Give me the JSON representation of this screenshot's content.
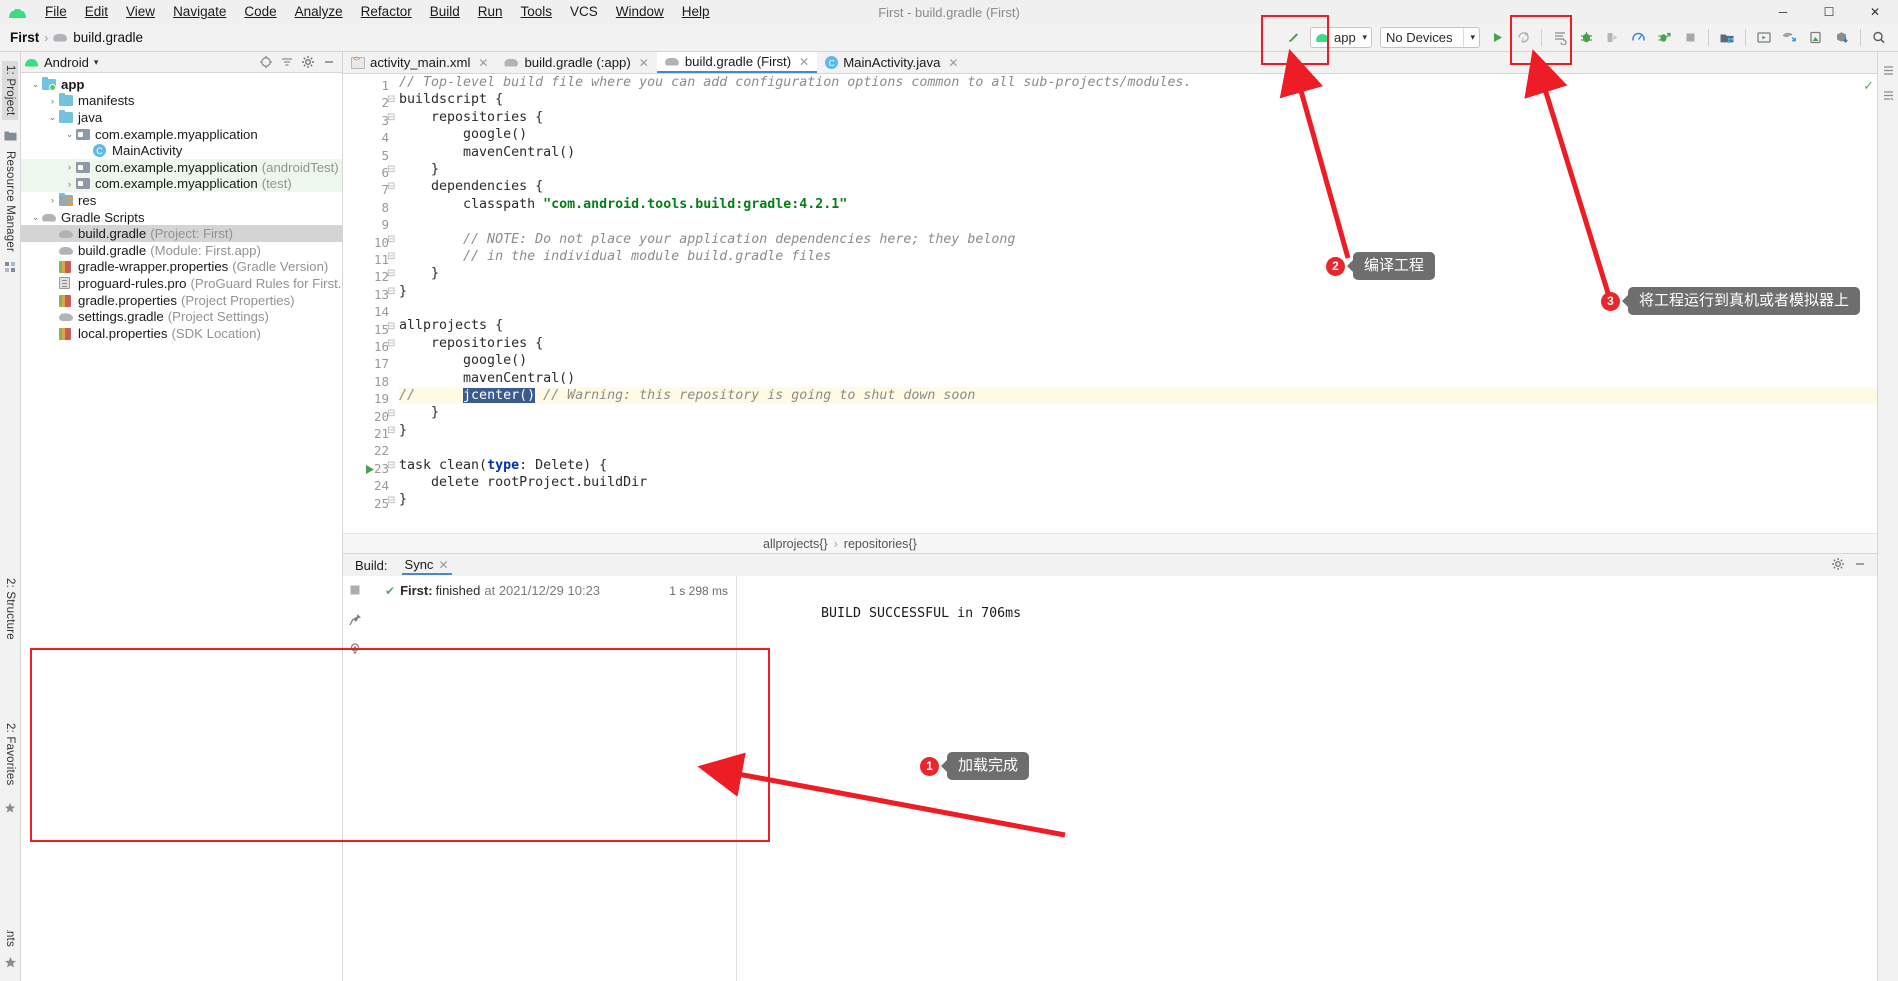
{
  "titlebar": {
    "window_title": "First - build.gradle (First)",
    "menus": [
      "File",
      "Edit",
      "View",
      "Navigate",
      "Code",
      "Analyze",
      "Refactor",
      "Build",
      "Run",
      "Tools",
      "VCS",
      "Window",
      "Help"
    ],
    "minimize": "─",
    "maximize": "☐",
    "close": "✕"
  },
  "navbar": {
    "breadcrumb_project": "First",
    "breadcrumb_separator": "›",
    "breadcrumb_file": "build.gradle",
    "module_combo": "app",
    "device_combo": "No Devices",
    "caret": "▾"
  },
  "tree": {
    "header_title": "Android",
    "items": [
      {
        "indent": 0,
        "arrow": "⌄",
        "icon": "folder-module",
        "name": "app",
        "desc": "",
        "bold": true,
        "selected": false,
        "test": false
      },
      {
        "indent": 1,
        "arrow": "›",
        "icon": "folder",
        "name": "manifests",
        "desc": "",
        "bold": false,
        "selected": false,
        "test": false
      },
      {
        "indent": 1,
        "arrow": "⌄",
        "icon": "folder",
        "name": "java",
        "desc": "",
        "bold": false,
        "selected": false,
        "test": false
      },
      {
        "indent": 2,
        "arrow": "⌄",
        "icon": "package",
        "name": "com.example.myapplication",
        "desc": "",
        "bold": false,
        "selected": false,
        "test": false
      },
      {
        "indent": 3,
        "arrow": "",
        "icon": "class",
        "name": "MainActivity",
        "desc": "",
        "bold": false,
        "selected": false,
        "test": false
      },
      {
        "indent": 2,
        "arrow": "›",
        "icon": "package",
        "name": "com.example.myapplication",
        "desc": "(androidTest)",
        "bold": false,
        "selected": false,
        "test": true
      },
      {
        "indent": 2,
        "arrow": "›",
        "icon": "package",
        "name": "com.example.myapplication",
        "desc": "(test)",
        "bold": false,
        "selected": false,
        "test": true
      },
      {
        "indent": 1,
        "arrow": "›",
        "icon": "folder-res",
        "name": "res",
        "desc": "",
        "bold": false,
        "selected": false,
        "test": false
      },
      {
        "indent": 0,
        "arrow": "⌄",
        "icon": "gradle",
        "name": "Gradle Scripts",
        "desc": "",
        "bold": false,
        "selected": false,
        "test": false
      },
      {
        "indent": 1,
        "arrow": "",
        "icon": "gradle",
        "name": "build.gradle",
        "desc": "(Project: First)",
        "bold": false,
        "selected": true,
        "test": false
      },
      {
        "indent": 1,
        "arrow": "",
        "icon": "gradle",
        "name": "build.gradle",
        "desc": "(Module: First.app)",
        "bold": false,
        "selected": false,
        "test": false
      },
      {
        "indent": 1,
        "arrow": "",
        "icon": "properties",
        "name": "gradle-wrapper.properties",
        "desc": "(Gradle Version)",
        "bold": false,
        "selected": false,
        "test": false
      },
      {
        "indent": 1,
        "arrow": "",
        "icon": "document",
        "name": "proguard-rules.pro",
        "desc": "(ProGuard Rules for First.app)",
        "bold": false,
        "selected": false,
        "test": false
      },
      {
        "indent": 1,
        "arrow": "",
        "icon": "properties",
        "name": "gradle.properties",
        "desc": "(Project Properties)",
        "bold": false,
        "selected": false,
        "test": false
      },
      {
        "indent": 1,
        "arrow": "",
        "icon": "gradle",
        "name": "settings.gradle",
        "desc": "(Project Settings)",
        "bold": false,
        "selected": false,
        "test": false
      },
      {
        "indent": 1,
        "arrow": "",
        "icon": "properties",
        "name": "local.properties",
        "desc": "(SDK Location)",
        "bold": false,
        "selected": false,
        "test": false
      }
    ]
  },
  "rails": {
    "left_top": [
      "1: Project",
      "Resource Manager"
    ],
    "left_bottom": [
      "Build Variants"
    ],
    "bottom_left": [
      "2: Structure",
      "2: Favorites"
    ]
  },
  "tabs": [
    {
      "label": "activity_main.xml",
      "icon": "xml-file-icon",
      "active": false,
      "close": "✕"
    },
    {
      "label": "build.gradle (:app)",
      "icon": "gradle-file-icon",
      "active": false,
      "close": "✕"
    },
    {
      "label": "build.gradle (First)",
      "icon": "gradle-file-icon",
      "active": true,
      "close": "✕"
    },
    {
      "label": "MainActivity.java",
      "icon": "java-file-icon",
      "active": false,
      "close": "✕"
    }
  ],
  "editor": {
    "lines": [
      {
        "n": 1,
        "fold": "",
        "hl": false,
        "parts": [
          {
            "t": "// Top-level build file where you can add configuration options common to all sub-projects/modules.",
            "c": "cmt"
          }
        ]
      },
      {
        "n": 2,
        "fold": "⊟",
        "hl": false,
        "parts": [
          {
            "t": "buildscript {",
            "c": ""
          }
        ]
      },
      {
        "n": 3,
        "fold": "⊟",
        "hl": false,
        "parts": [
          {
            "t": "    repositories {",
            "c": ""
          }
        ]
      },
      {
        "n": 4,
        "fold": "",
        "hl": false,
        "parts": [
          {
            "t": "        google()",
            "c": ""
          }
        ]
      },
      {
        "n": 5,
        "fold": "",
        "hl": false,
        "parts": [
          {
            "t": "        mavenCentral()",
            "c": ""
          }
        ]
      },
      {
        "n": 6,
        "fold": "⊟",
        "hl": false,
        "parts": [
          {
            "t": "    }",
            "c": ""
          }
        ]
      },
      {
        "n": 7,
        "fold": "⊟",
        "hl": false,
        "parts": [
          {
            "t": "    dependencies {",
            "c": ""
          }
        ]
      },
      {
        "n": 8,
        "fold": "",
        "hl": false,
        "parts": [
          {
            "t": "        classpath ",
            "c": ""
          },
          {
            "t": "\"com.android.tools.build:gradle:4.2.1\"",
            "c": "str"
          }
        ]
      },
      {
        "n": 9,
        "fold": "",
        "hl": false,
        "parts": [
          {
            "t": "",
            "c": ""
          }
        ]
      },
      {
        "n": 10,
        "fold": "⊟",
        "hl": false,
        "parts": [
          {
            "t": "        // NOTE: Do not place your application dependencies here; they belong",
            "c": "cmt"
          }
        ]
      },
      {
        "n": 11,
        "fold": "⊟",
        "hl": false,
        "parts": [
          {
            "t": "        // in the individual module build.gradle files",
            "c": "cmt"
          }
        ]
      },
      {
        "n": 12,
        "fold": "⊟",
        "hl": false,
        "parts": [
          {
            "t": "    }",
            "c": ""
          }
        ]
      },
      {
        "n": 13,
        "fold": "⊟",
        "hl": false,
        "parts": [
          {
            "t": "}",
            "c": ""
          }
        ]
      },
      {
        "n": 14,
        "fold": "",
        "hl": false,
        "parts": [
          {
            "t": "",
            "c": ""
          }
        ]
      },
      {
        "n": 15,
        "fold": "⊟",
        "hl": false,
        "parts": [
          {
            "t": "allprojects {",
            "c": ""
          }
        ]
      },
      {
        "n": 16,
        "fold": "⊟",
        "hl": false,
        "parts": [
          {
            "t": "    repositories {",
            "c": ""
          }
        ]
      },
      {
        "n": 17,
        "fold": "",
        "hl": false,
        "parts": [
          {
            "t": "        google()",
            "c": ""
          }
        ]
      },
      {
        "n": 18,
        "fold": "",
        "hl": false,
        "parts": [
          {
            "t": "        mavenCentral()",
            "c": ""
          }
        ]
      },
      {
        "n": 19,
        "fold": "",
        "hl": true,
        "parts": [
          {
            "t": "//      ",
            "c": "cmt"
          },
          {
            "t": "jcenter()",
            "c": "sel"
          },
          {
            "t": " // Warning: this repository is going to shut down soon",
            "c": "cmt"
          }
        ]
      },
      {
        "n": 20,
        "fold": "⊟",
        "hl": false,
        "parts": [
          {
            "t": "    }",
            "c": ""
          }
        ]
      },
      {
        "n": 21,
        "fold": "⊟",
        "hl": false,
        "parts": [
          {
            "t": "}",
            "c": ""
          }
        ]
      },
      {
        "n": 22,
        "fold": "",
        "hl": false,
        "parts": [
          {
            "t": "",
            "c": ""
          }
        ]
      },
      {
        "n": 23,
        "fold": "⊟",
        "hl": false,
        "run": true,
        "parts": [
          {
            "t": "task clean(",
            "c": ""
          },
          {
            "t": "type",
            "c": "kw"
          },
          {
            "t": ": Delete) {",
            "c": ""
          }
        ]
      },
      {
        "n": 24,
        "fold": "",
        "hl": false,
        "parts": [
          {
            "t": "    delete rootProject.buildDir",
            "c": ""
          }
        ]
      },
      {
        "n": 25,
        "fold": "⊟",
        "hl": false,
        "parts": [
          {
            "t": "}",
            "c": ""
          }
        ]
      }
    ],
    "breadcrumb": [
      "allprojects{}",
      "repositories{}"
    ],
    "breadcrumb_sep": "›",
    "inspection_ok": "✓"
  },
  "build_panel": {
    "label": "Build:",
    "tab": "Sync",
    "tab_close": "✕",
    "row": {
      "check": "✔",
      "name": "First:",
      "status": "finished",
      "at_text": "at 2021/12/29 10:23",
      "duration": "1 s 298 ms"
    },
    "output": "BUILD SUCCESSFUL in 706ms"
  },
  "annotations": [
    {
      "id": "1",
      "text": "加载完成"
    },
    {
      "id": "2",
      "text": "编译工程"
    },
    {
      "id": "3",
      "text": "将工程运行到真机或者模拟器上"
    }
  ],
  "colors": {
    "accent": "#4a86c8",
    "annotation_red": "#ee1c25",
    "badge_red": "#e8262d",
    "bubble_grey": "#6e6e6e",
    "android_green": "#3ddc84",
    "success_green": "#59a869",
    "highlight_yellow": "#fffae3",
    "selection_blue": "#3b5a8f"
  }
}
